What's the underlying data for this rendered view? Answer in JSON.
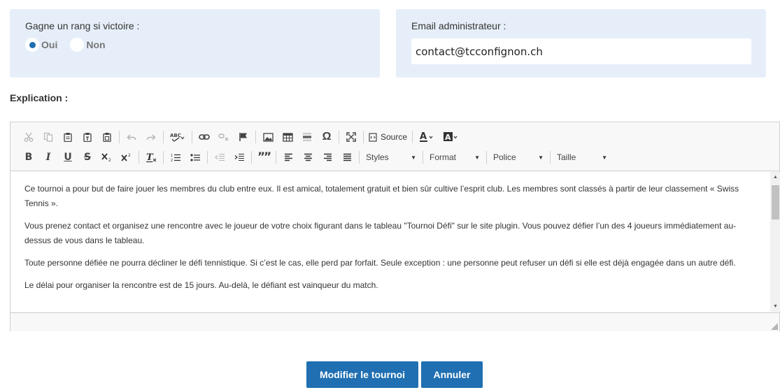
{
  "rank_panel": {
    "label": "Gagne un rang si victoire :",
    "options": [
      {
        "label": "Oui",
        "checked": true
      },
      {
        "label": "Non",
        "checked": false
      }
    ]
  },
  "email_panel": {
    "label": "Email administrateur :",
    "value": "contact@tcconfignon.ch"
  },
  "explication": {
    "label": "Explication :"
  },
  "editor": {
    "toolbar": {
      "source_label": "Source",
      "combos": {
        "styles": "Styles",
        "format": "Format",
        "police": "Police",
        "taille": "Taille"
      },
      "bold": "B",
      "italic": "I",
      "underline": "U",
      "strike": "S",
      "quote": "””"
    },
    "paragraphs": [
      "Ce tournoi a pour but de faire jouer les membres du club entre eux. Il est amical, totalement gratuit et bien sûr cultive l’esprit club. Les membres sont classés à partir de leur classement « Swiss Tennis ».",
      "Vous prenez contact et organisez une rencontre avec le joueur de votre choix figurant dans le tableau \"Tournoi Défi\" sur le site plugin. Vous pouvez défier l’un des 4 joueurs immédiatement au-dessus de vous dans le tableau.",
      "Toute personne défiée ne pourra décliner le défi tennistique. Si c’est le cas, elle perd par forfait. Seule exception : une personne peut refuser un défi si elle est déjà engagée dans un autre défi.",
      "Le délai pour organiser la rencontre est de 15 jours. Au-delà, le défiant est vainqueur du match."
    ]
  },
  "actions": {
    "submit": "Modifier le tournoi",
    "cancel": "Annuler"
  },
  "colors": {
    "panel_bg": "#e6eff9",
    "primary": "#1f6fb2"
  }
}
